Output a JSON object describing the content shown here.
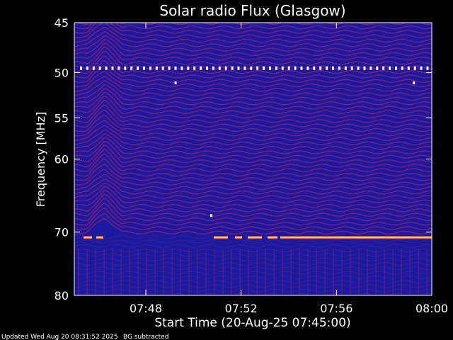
{
  "chart_data": {
    "type": "heatmap",
    "title": "Solar radio Flux (Glasgow)",
    "xlabel": "Start Time (20-Aug-25 07:45:00)",
    "ylabel": "Frequency [MHz]",
    "x_range": [
      "07:45:00",
      "08:00:00"
    ],
    "x_ticks": [
      "07:48",
      "07:52",
      "07:56",
      "08:00"
    ],
    "y_range": [
      45,
      80
    ],
    "y_scale": "log",
    "y_ticks": [
      45,
      50,
      55,
      60,
      70,
      80
    ],
    "grid": false,
    "annotations": {
      "interference_line_mhz": 49.5,
      "continuous_band_mhz": 70.8,
      "isolated_dots": [
        {
          "time": "07:49:15",
          "mhz": 51.1
        },
        {
          "time": "07:50:45",
          "mhz": 67.6
        },
        {
          "time": "07:59:15",
          "mhz": 51.1
        }
      ]
    },
    "colors": {
      "background_field": "#1a1aa0",
      "stripes": "#b02060",
      "band": "#ff6a2a",
      "band_core": "#ffe070"
    }
  },
  "footer": {
    "updated": "Updated Wed Aug 20 08:31:52 2025",
    "note": "BG subtracted"
  }
}
